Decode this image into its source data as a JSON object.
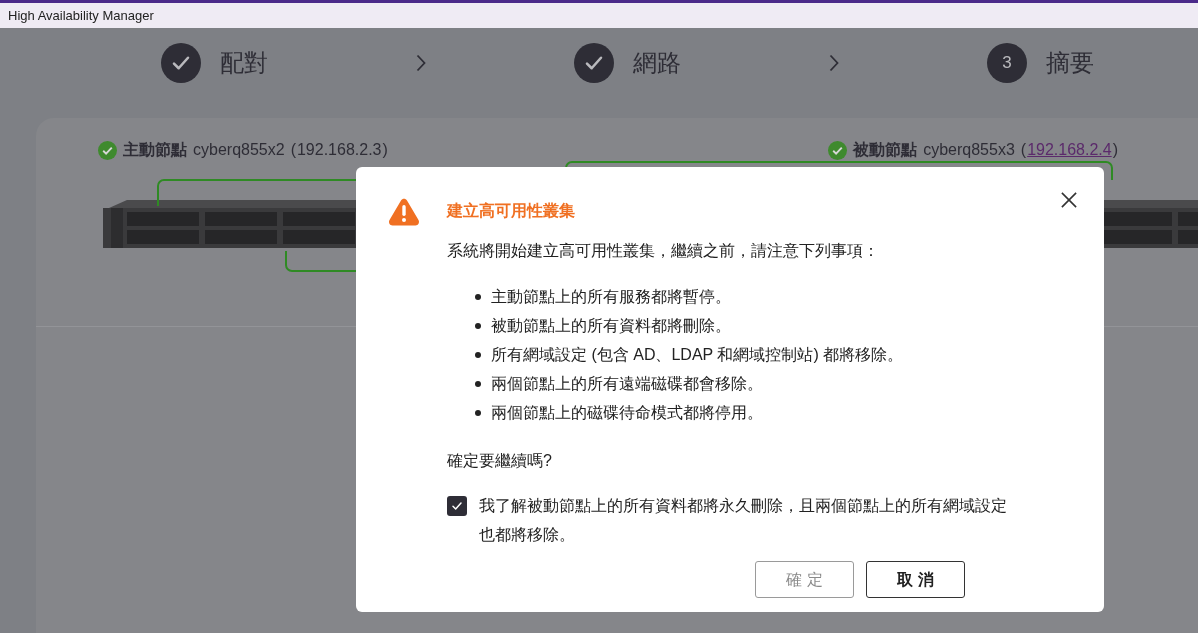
{
  "window": {
    "title": "High Availability Manager"
  },
  "steps": [
    {
      "done": true,
      "label": "配對"
    },
    {
      "done": true,
      "label": "網路"
    },
    {
      "done": false,
      "number": "3",
      "label": "摘要"
    }
  ],
  "nodes": [
    {
      "ok": true,
      "role": "主動節點",
      "name": "cyberq855x2",
      "address_open": "(",
      "address": "192.168.2.3",
      "address_close": ")",
      "linked": false
    },
    {
      "ok": true,
      "role": "被動節點",
      "name": "cyberq855x3",
      "address_open": "(",
      "address": "192.168.2.4",
      "address_close": ")",
      "linked": true
    }
  ],
  "dialog": {
    "title": "建立高可用性叢集",
    "intro": "系統將開始建立高可用性叢集，繼續之前，請注意下列事項：",
    "items": [
      "主動節點上的所有服務都將暫停。",
      "被動節點上的所有資料都將刪除。",
      "所有網域設定 (包含 AD、LDAP 和網域控制站) 都將移除。",
      "兩個節點上的所有遠端磁碟都會移除。",
      "兩個節點上的磁碟待命模式都將停用。"
    ],
    "question": "確定要繼續嗎?",
    "acknowledge": {
      "label": "我了解被動節點上的所有資料都將永久刪除，且兩個節點上的所有網域設定也都將移除。",
      "checked": true
    },
    "buttons": [
      {
        "label": "確 定",
        "disabled": true
      },
      {
        "label": "取 消",
        "disabled": false
      }
    ]
  }
}
